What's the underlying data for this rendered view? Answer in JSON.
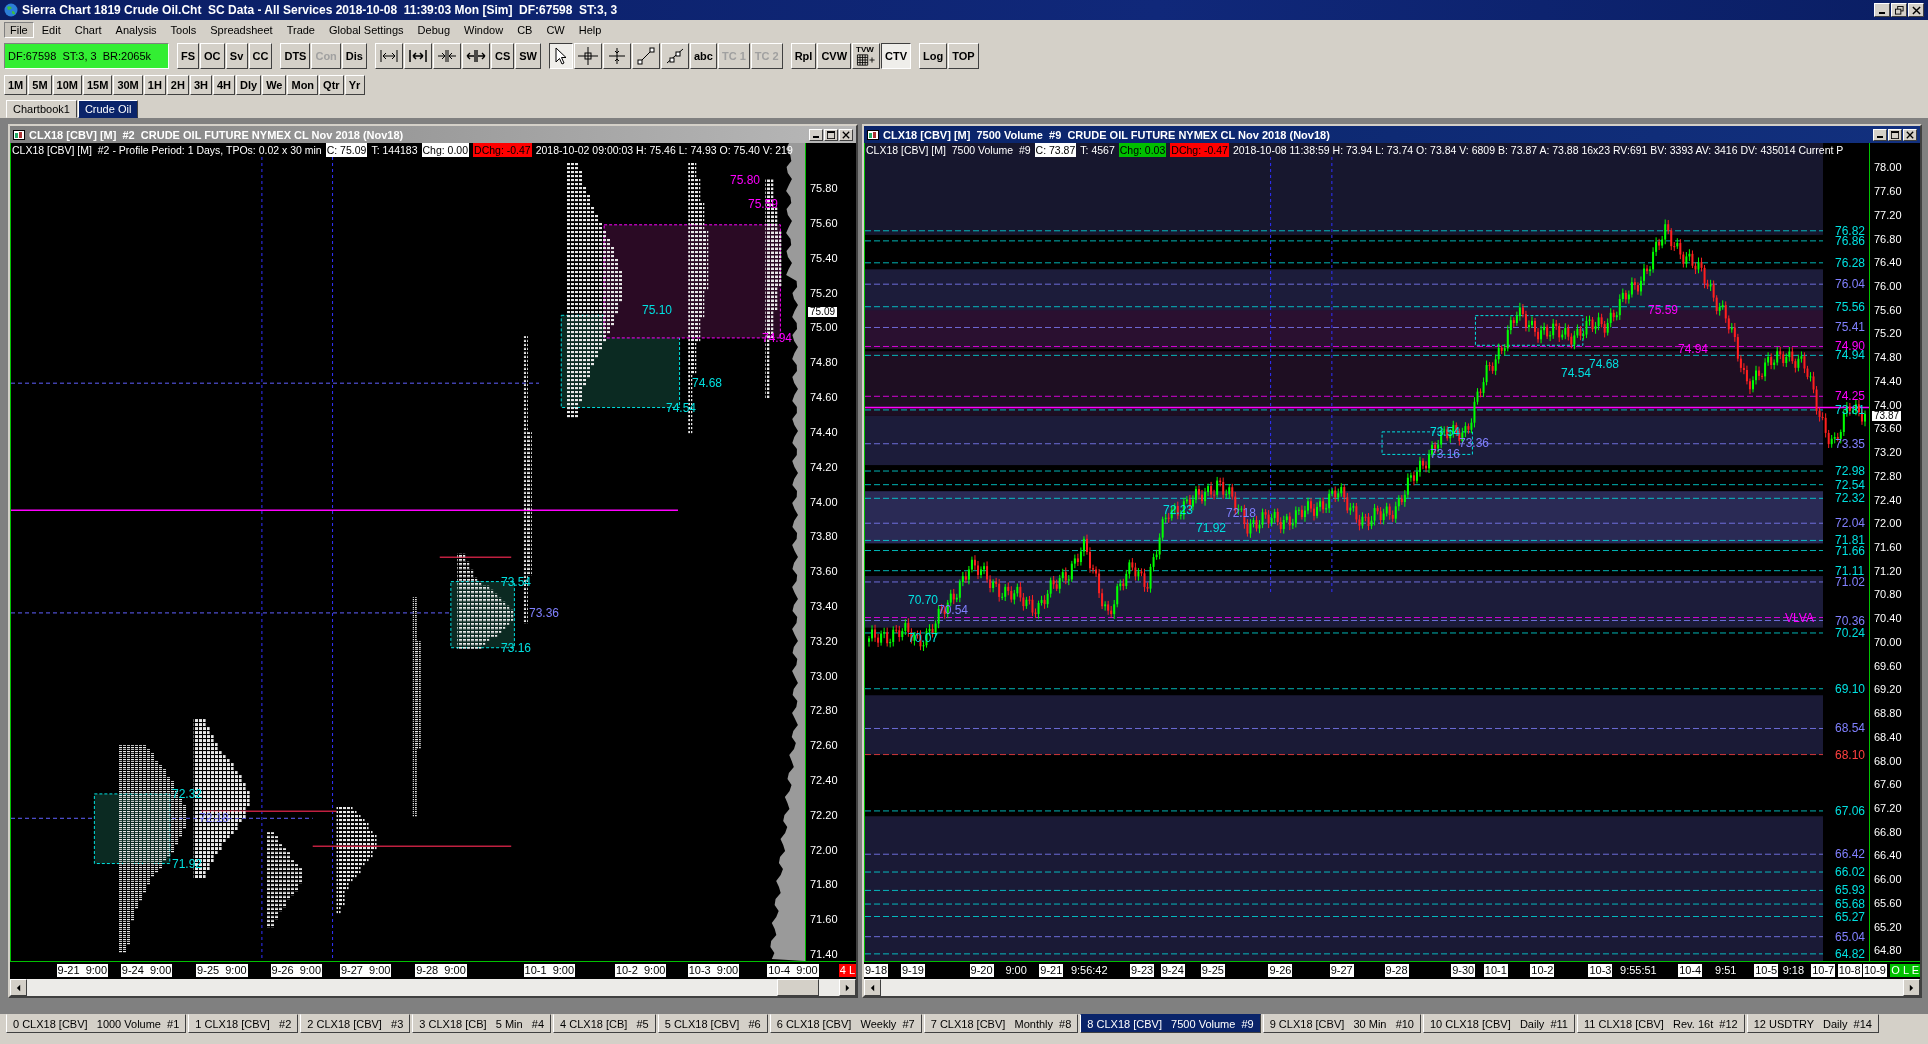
{
  "window": {
    "title": "Sierra Chart 1819 Crude Oil.Cht  SC Data - All Services 2018-10-08  11:39:03 Mon [Sim]  DF:67598  ST:3, 3"
  },
  "menu": [
    {
      "label": "File",
      "selected": true
    },
    {
      "label": "Edit",
      "selected": false
    },
    {
      "label": "Chart",
      "selected": false
    },
    {
      "label": "Analysis",
      "selected": false
    },
    {
      "label": "Tools",
      "selected": false
    },
    {
      "label": "Spreadsheet",
      "selected": false
    },
    {
      "label": "Trade",
      "selected": false
    },
    {
      "label": "Global Settings",
      "selected": false
    },
    {
      "label": "Debug",
      "selected": false
    },
    {
      "label": "Window",
      "selected": false
    },
    {
      "label": "CB",
      "selected": false
    },
    {
      "label": "CW",
      "selected": false
    },
    {
      "label": "Help",
      "selected": false
    }
  ],
  "status_box": {
    "text": "DF:67598  ST:3, 3  BR:2065k"
  },
  "toolbar": [
    [
      {
        "kind": "text",
        "label": "FS",
        "disabled": false,
        "selected": false
      },
      {
        "kind": "text",
        "label": "OC",
        "disabled": false,
        "selected": false
      },
      {
        "kind": "text",
        "label": "Sv",
        "disabled": false,
        "selected": false
      },
      {
        "kind": "text",
        "label": "CC",
        "disabled": false,
        "selected": false
      }
    ],
    [
      {
        "kind": "text",
        "label": "DTS",
        "disabled": false,
        "selected": false
      },
      {
        "kind": "text",
        "label": "Con",
        "disabled": true,
        "selected": false
      },
      {
        "kind": "text",
        "label": "Dis",
        "disabled": false,
        "selected": false
      }
    ],
    [
      {
        "kind": "spanwide",
        "disabled": false,
        "selected": false
      },
      {
        "kind": "spannarrow",
        "disabled": false,
        "selected": false
      },
      {
        "kind": "squeeze",
        "disabled": false,
        "selected": false
      },
      {
        "kind": "stretch",
        "disabled": false,
        "selected": false
      },
      {
        "kind": "text",
        "label": "CS",
        "disabled": false,
        "selected": false
      },
      {
        "kind": "text",
        "label": "SW",
        "disabled": false,
        "selected": false
      }
    ],
    [
      {
        "kind": "pointer",
        "disabled": false,
        "selected": true
      },
      {
        "kind": "crosshair",
        "disabled": false,
        "selected": false
      },
      {
        "kind": "cursor",
        "disabled": false,
        "selected": false
      },
      {
        "kind": "line",
        "disabled": false,
        "selected": false
      },
      {
        "kind": "ray",
        "disabled": false,
        "selected": false
      },
      {
        "kind": "text",
        "label": "abc",
        "disabled": false,
        "selected": false
      },
      {
        "kind": "text",
        "label": "TC 1",
        "disabled": true,
        "selected": false
      },
      {
        "kind": "text",
        "label": "TC 2",
        "disabled": true,
        "selected": false
      }
    ],
    [
      {
        "kind": "text",
        "label": "Rpl",
        "disabled": false,
        "selected": false
      },
      {
        "kind": "text",
        "label": "CVW",
        "disabled": false,
        "selected": false
      },
      {
        "kind": "grid",
        "label": "TVW",
        "disabled": false,
        "selected": false
      },
      {
        "kind": "text",
        "label": "CTV",
        "disabled": false,
        "selected": true
      }
    ],
    [
      {
        "kind": "text",
        "label": "Log",
        "disabled": false,
        "selected": false
      },
      {
        "kind": "text",
        "label": "TOP",
        "disabled": false,
        "selected": false
      }
    ]
  ],
  "timeframes": [
    "1M",
    "5M",
    "10M",
    "15M",
    "30M",
    "1H",
    "2H",
    "3H",
    "4H",
    "Dly",
    "We",
    "Mon",
    "Qtr",
    "Yr"
  ],
  "chartbook_tabs": [
    {
      "label": "Chartbook1",
      "selected": false
    },
    {
      "label": "Crude Oil",
      "selected": true
    }
  ],
  "charts": [
    {
      "kind": "tpo",
      "title": "CLX18 [CBV] [M]  #2  CRUDE OIL FUTURE NYMEX CL Nov 2018 (Nov18)",
      "active": false,
      "header": [
        {
          "kind": "plain",
          "text": "CLX18 [CBV] [M]  #2 - Profile Period: 1 Days, TPOs: 0.02 x 30 min"
        },
        {
          "kind": "light",
          "text": "C: 75.09"
        },
        {
          "kind": "plain",
          "text": "T: 144183"
        },
        {
          "kind": "light",
          "text": "Chg: 0.00"
        },
        {
          "kind": "down",
          "text": "DChg: -0.47"
        },
        {
          "kind": "plain",
          "text": "2018-10-02 09:00:03 H: 75.46 L: 74.93 O: 75.40 V: 219"
        }
      ],
      "price_axis": [
        "75.80",
        "75.60",
        "75.40",
        "75.20",
        "75.00",
        "74.80",
        "74.60",
        "74.40",
        "74.20",
        "74.00",
        "73.80",
        "73.60",
        "73.40",
        "73.20",
        "73.00",
        "72.80",
        "72.60",
        "72.40",
        "72.20",
        "72.00",
        "71.80",
        "71.60",
        "71.40"
      ],
      "current_price": "75.09",
      "plot_labels": [
        {
          "text": "75.80",
          "color": "#ff00ff"
        },
        {
          "text": "75.59",
          "color": "#ff00ff"
        },
        {
          "text": "75.10",
          "color": "#00e0e0"
        },
        {
          "text": "74.94",
          "color": "#ff00ff"
        },
        {
          "text": "74.68",
          "color": "#00e0e0"
        },
        {
          "text": "74.54",
          "color": "#00e0e0"
        },
        {
          "text": "73.54",
          "color": "#00e0e0"
        },
        {
          "text": "73.36",
          "color": "#8080ff"
        },
        {
          "text": "73.16",
          "color": "#00e0e0"
        },
        {
          "text": "72.32",
          "color": "#00e0e0"
        },
        {
          "text": "72.18",
          "color": "#8080ff"
        },
        {
          "text": "71.92",
          "color": "#00e0e0"
        }
      ],
      "time_axis": [
        {
          "kind": "date",
          "text": "9-21  9:00"
        },
        {
          "kind": "date",
          "text": "9-24  9:00"
        },
        {
          "kind": "date",
          "text": "9-25  9:00"
        },
        {
          "kind": "date",
          "text": "9-26  9:00"
        },
        {
          "kind": "date",
          "text": "9-27  9:00"
        },
        {
          "kind": "date",
          "text": "9-28  9:00"
        },
        {
          "kind": "date",
          "text": "10-1  9:00"
        },
        {
          "kind": "date",
          "text": "10-2  9:00"
        },
        {
          "kind": "date",
          "text": "10-3  9:00"
        },
        {
          "kind": "date",
          "text": "10-4  9:00"
        },
        {
          "kind": "flag",
          "text": "4 L",
          "color": "#ff0000"
        }
      ]
    },
    {
      "kind": "candles",
      "title": "CLX18 [CBV] [M]  7500 Volume  #9  CRUDE OIL FUTURE NYMEX CL Nov 2018 (Nov18)",
      "active": true,
      "header": [
        {
          "kind": "plain",
          "text": "CLX18 [CBV] [M]  7500 Volume  #9"
        },
        {
          "kind": "light",
          "text": "C: 73.87"
        },
        {
          "kind": "plain",
          "text": "T: 4567"
        },
        {
          "kind": "up",
          "text": "Chg: 0.03"
        },
        {
          "kind": "down",
          "text": "DChg: -0.47"
        },
        {
          "kind": "plain",
          "text": "2018-10-08 11:38:59 H: 73.94 L: 73.74 O: 73.84 V: 6809 B: 73.87 A: 73.88 16x23 RV:691 BV: 3393 AV: 3416 DV: 435014 Current P"
        }
      ],
      "price_axis": [
        "78.00",
        "77.60",
        "77.20",
        "76.80",
        "76.40",
        "76.00",
        "75.60",
        "75.20",
        "74.80",
        "74.40",
        "74.00",
        "73.60",
        "73.20",
        "72.80",
        "72.40",
        "72.00",
        "71.60",
        "71.20",
        "70.80",
        "70.40",
        "70.00",
        "69.60",
        "69.20",
        "68.80",
        "68.40",
        "68.00",
        "67.60",
        "67.20",
        "66.80",
        "66.40",
        "66.00",
        "65.60",
        "65.20",
        "64.80"
      ],
      "current_price": "73.87",
      "plot_labels": [
        {
          "text": "75.59",
          "color": "#ff00ff"
        },
        {
          "text": "74.94",
          "color": "#ff00ff"
        },
        {
          "text": "74.68",
          "color": "#00e0e0"
        },
        {
          "text": "74.54",
          "color": "#00e0e0"
        },
        {
          "text": "73.54",
          "color": "#00e0e0"
        },
        {
          "text": "73.36",
          "color": "#8080ff"
        },
        {
          "text": "73.16",
          "color": "#8080ff"
        },
        {
          "text": "72.23",
          "color": "#00e0e0"
        },
        {
          "text": "72.18",
          "color": "#8080ff"
        },
        {
          "text": "71.92",
          "color": "#00e0e0"
        },
        {
          "text": "70.70",
          "color": "#00e0e0"
        },
        {
          "text": "70.54",
          "color": "#8080ff"
        },
        {
          "text": "70.07",
          "color": "#00e0e0"
        }
      ],
      "levels": [
        {
          "text": "76.82",
          "color": "#00e0e0"
        },
        {
          "text": "76.86",
          "color": "#00e0e0"
        },
        {
          "text": "76.28",
          "color": "#00e0e0"
        },
        {
          "text": "76.04",
          "color": "#8080ff"
        },
        {
          "text": "75.56",
          "color": "#00e0e0"
        },
        {
          "text": "75.41",
          "color": "#8080ff"
        },
        {
          "text": "74.90",
          "color": "#ff00ff"
        },
        {
          "text": "74.94",
          "color": "#00e0e0"
        },
        {
          "text": "74.25",
          "color": "#ff00ff"
        },
        {
          "text": "73.81",
          "color": "#00e0e0"
        },
        {
          "text": "73.35",
          "color": "#8080ff"
        },
        {
          "text": "72.98",
          "color": "#00e0e0"
        },
        {
          "text": "72.54",
          "color": "#00e0e0"
        },
        {
          "text": "72.32",
          "color": "#00e0e0"
        },
        {
          "text": "72.04",
          "color": "#8080ff"
        },
        {
          "text": "71.81",
          "color": "#00e0e0"
        },
        {
          "text": "71.66",
          "color": "#00e0e0"
        },
        {
          "text": "71.11",
          "color": "#00e0e0"
        },
        {
          "text": "71.02",
          "color": "#8080ff"
        },
        {
          "text": "VLVA",
          "color": "#ff00ff"
        },
        {
          "text": "70.36",
          "color": "#8080ff"
        },
        {
          "text": "70.24",
          "color": "#00e0e0"
        },
        {
          "text": "69.10",
          "color": "#00e0e0"
        },
        {
          "text": "68.54",
          "color": "#8080ff"
        },
        {
          "text": "68.10",
          "color": "#ff4040"
        },
        {
          "text": "67.06",
          "color": "#00e0e0"
        },
        {
          "text": "66.42",
          "color": "#8080ff"
        },
        {
          "text": "66.02",
          "color": "#00e0e0"
        },
        {
          "text": "65.93",
          "color": "#00e0e0"
        },
        {
          "text": "65.68",
          "color": "#00e0e0"
        },
        {
          "text": "65.27",
          "color": "#00e0e0"
        },
        {
          "text": "65.04",
          "color": "#8080ff"
        },
        {
          "text": "64.82",
          "color": "#00e0e0"
        }
      ],
      "time_axis": [
        {
          "kind": "date",
          "text": "9-18"
        },
        {
          "kind": "date",
          "text": "9-19"
        },
        {
          "kind": "date",
          "text": "9-20"
        },
        {
          "kind": "time",
          "text": "9:00"
        },
        {
          "kind": "date",
          "text": "9-21"
        },
        {
          "kind": "time",
          "text": "9:56:42"
        },
        {
          "kind": "date",
          "text": "9-23"
        },
        {
          "kind": "date",
          "text": "9-24"
        },
        {
          "kind": "date",
          "text": "9-25"
        },
        {
          "kind": "date",
          "text": "9-26"
        },
        {
          "kind": "date",
          "text": "9-27"
        },
        {
          "kind": "date",
          "text": "9-28"
        },
        {
          "kind": "date",
          "text": "9-30"
        },
        {
          "kind": "date",
          "text": "10-1"
        },
        {
          "kind": "date",
          "text": "10-2"
        },
        {
          "kind": "date",
          "text": "10-3"
        },
        {
          "kind": "time",
          "text": "9:55:51"
        },
        {
          "kind": "date",
          "text": "10-4"
        },
        {
          "kind": "time",
          "text": "9:51"
        },
        {
          "kind": "date",
          "text": "10-5"
        },
        {
          "kind": "time",
          "text": "9:18"
        },
        {
          "kind": "date",
          "text": "10-7"
        },
        {
          "kind": "date",
          "text": "10-8"
        },
        {
          "kind": "date",
          "text": "10-9"
        },
        {
          "kind": "flag",
          "text": "O L E",
          "color": "#00c000"
        }
      ]
    }
  ],
  "bottom_tabs": [
    {
      "label": "0 CLX18 [CBV]   1000 Volume  #1",
      "selected": false
    },
    {
      "label": "1 CLX18 [CBV]   #2",
      "selected": false
    },
    {
      "label": "2 CLX18 [CBV]   #3",
      "selected": false
    },
    {
      "label": "3 CLX18 [CB]   5 Min   #4",
      "selected": false
    },
    {
      "label": "4 CLX18 [CB]   #5",
      "selected": false
    },
    {
      "label": "5 CLX18 [CBV]   #6",
      "selected": false
    },
    {
      "label": "6 CLX18 [CBV]   Weekly  #7",
      "selected": false
    },
    {
      "label": "7 CLX18 [CBV]   Monthly  #8",
      "selected": false
    },
    {
      "label": "8 CLX18 [CBV]   7500 Volume  #9",
      "selected": true
    },
    {
      "label": "9 CLX18 [CBV]   30 Min   #10",
      "selected": false
    },
    {
      "label": "10 CLX18 [CBV]   Daily  #11",
      "selected": false
    },
    {
      "label": "11 CLX18 [CBV]   Rev. 16t  #12",
      "selected": false
    },
    {
      "label": "12 USDTRY   Daily  #14",
      "selected": false
    }
  ]
}
